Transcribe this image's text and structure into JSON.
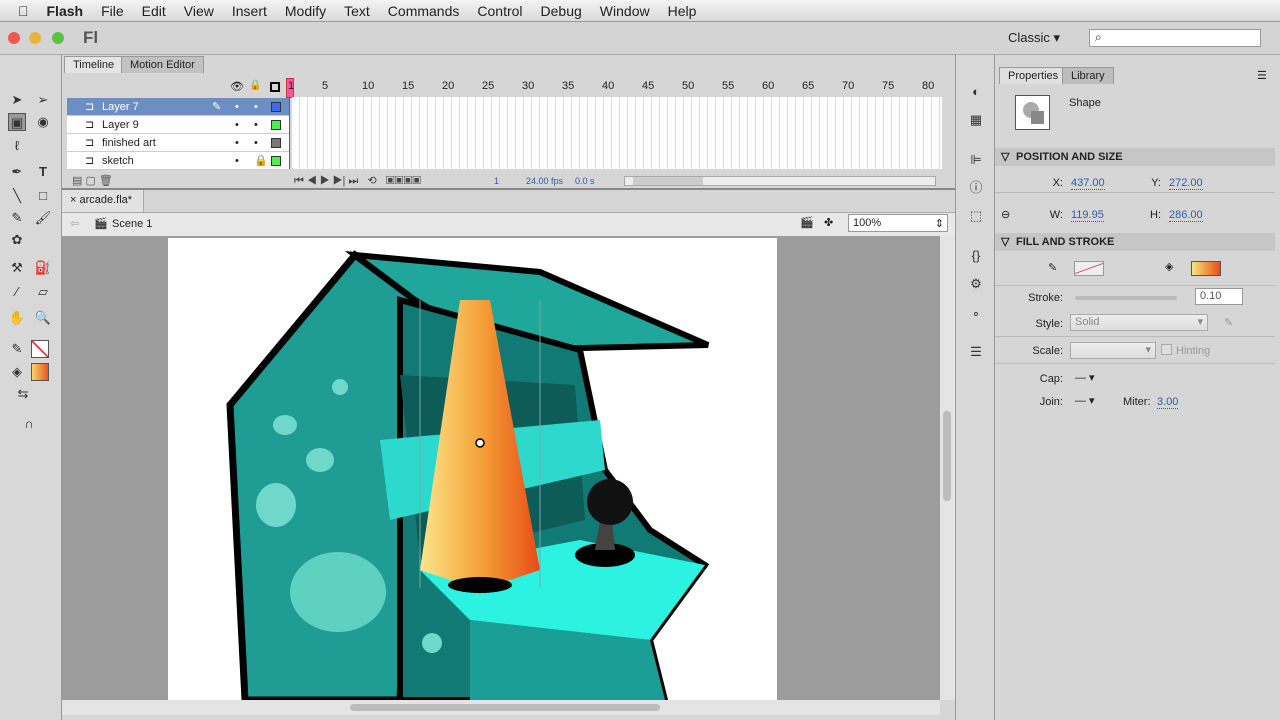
{
  "menubar": {
    "app": "Flash",
    "items": [
      "File",
      "Edit",
      "View",
      "Insert",
      "Modify",
      "Text",
      "Commands",
      "Control",
      "Debug",
      "Window",
      "Help"
    ]
  },
  "titlebar": {
    "logo": "Fl",
    "workspace": "Classic ▾",
    "search_placeholder": ""
  },
  "timeline": {
    "tabs": [
      "Timeline",
      "Motion Editor"
    ],
    "frame_numbers": [
      "1",
      "5",
      "10",
      "15",
      "20",
      "25",
      "30",
      "35",
      "40",
      "45",
      "50",
      "55",
      "60",
      "65",
      "70",
      "75",
      "80"
    ],
    "layers": [
      {
        "name": "Layer 7",
        "color": "#3a6bf0"
      },
      {
        "name": "Layer 9",
        "color": "#4cf04c"
      },
      {
        "name": "finished art",
        "color": "#777777"
      },
      {
        "name": "sketch",
        "color": "#4cf04c"
      }
    ],
    "current_frame": "1",
    "fps": "24.00 fps",
    "time": "0.0 s"
  },
  "document": {
    "tab": "arcade.fla*",
    "scene": "Scene 1",
    "zoom": "100%"
  },
  "properties": {
    "tabs": [
      "Properties",
      "Library"
    ],
    "type": "Shape",
    "pos_title": "POSITION AND SIZE",
    "x_label": "X:",
    "x": "437.00",
    "y_label": "Y:",
    "y": "272.00",
    "w_label": "W:",
    "w": "119.95",
    "h_label": "H:",
    "h": "286.00",
    "fill_title": "FILL AND STROKE",
    "stroke_label": "Stroke:",
    "stroke": "0.10",
    "style_label": "Style:",
    "style": "Solid",
    "scale_label": "Scale:",
    "hinting": "Hinting",
    "cap_label": "Cap:",
    "join_label": "Join:",
    "miter_label": "Miter:",
    "miter": "3.00"
  }
}
